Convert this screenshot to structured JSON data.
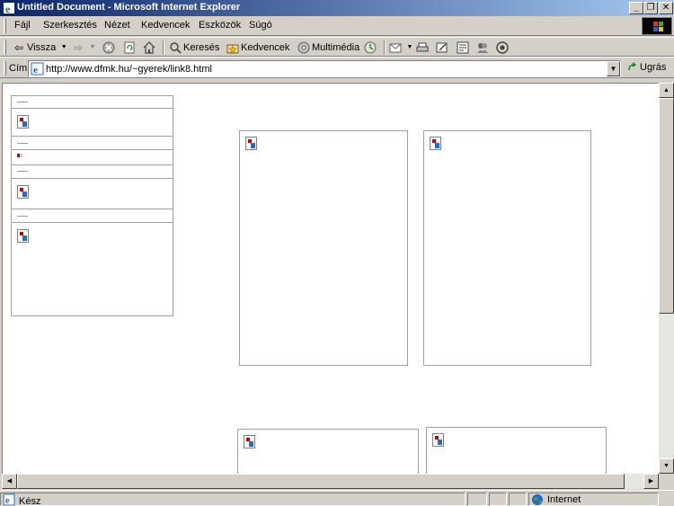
{
  "window": {
    "title": "Untitled Document - Microsoft Internet Explorer",
    "minimize_glyph": "_",
    "maximize_glyph": "❐",
    "close_glyph": "✕"
  },
  "menu": {
    "items": [
      {
        "label": "Fájl"
      },
      {
        "label": "Szerkesztés"
      },
      {
        "label": "Nézet"
      },
      {
        "label": "Kedvencek"
      },
      {
        "label": "Eszközök"
      },
      {
        "label": "Súgó"
      }
    ]
  },
  "toolbar": {
    "back_label": "Vissza",
    "search_label": "Keresés",
    "favorites_label": "Kedvencek",
    "media_label": "Multimédia"
  },
  "address": {
    "label": "Cím",
    "url": "http://www.dfmk.hu/~gyerek/link8.html",
    "go_label": "Ugrás"
  },
  "status": {
    "text": "Kész",
    "zone": "Internet"
  },
  "colors": {
    "title_gradient_start": "#0a246a",
    "title_gradient_end": "#a6caf0",
    "chrome": "#d4d0c8"
  }
}
